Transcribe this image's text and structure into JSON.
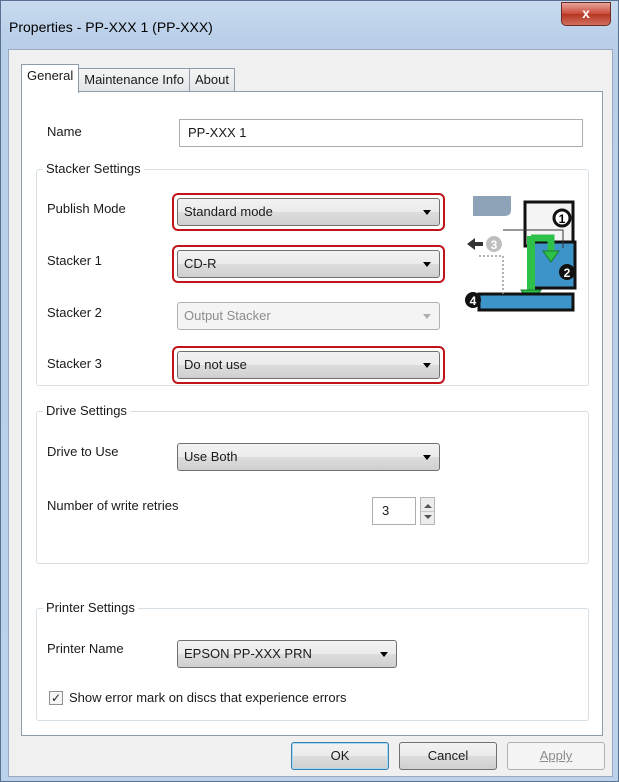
{
  "window": {
    "title": "Properties - PP-XXX 1 (PP-XXX)",
    "close_label": "x"
  },
  "tabs": [
    {
      "label": "General"
    },
    {
      "label": "Maintenance Info"
    },
    {
      "label": "About"
    }
  ],
  "general": {
    "name_label": "Name",
    "name_value": "PP-XXX 1",
    "stacker_settings": {
      "title": "Stacker Settings",
      "publish_mode_label": "Publish Mode",
      "publish_mode_value": "Standard mode",
      "stacker1_label": "Stacker 1",
      "stacker1_value": "CD-R",
      "stacker2_label": "Stacker 2",
      "stacker2_value": "Output Stacker",
      "stacker3_label": "Stacker 3",
      "stacker3_value": "Do not use",
      "diagram_numbers": [
        "1",
        "2",
        "3",
        "4"
      ],
      "highlight_color": "#c0141a"
    },
    "drive_settings": {
      "title": "Drive Settings",
      "drive_label": "Drive to Use",
      "drive_value": "Use Both",
      "retries_label": "Number of write retries",
      "retries_value": "3"
    },
    "printer_settings": {
      "title": "Printer Settings",
      "printer_name_label": "Printer Name",
      "printer_name_value": "EPSON PP-XXX PRN",
      "show_error_label": "Show error mark on discs that experience errors",
      "show_error_checked": true
    }
  },
  "buttons": {
    "ok": "OK",
    "cancel": "Cancel",
    "apply": "Apply"
  }
}
